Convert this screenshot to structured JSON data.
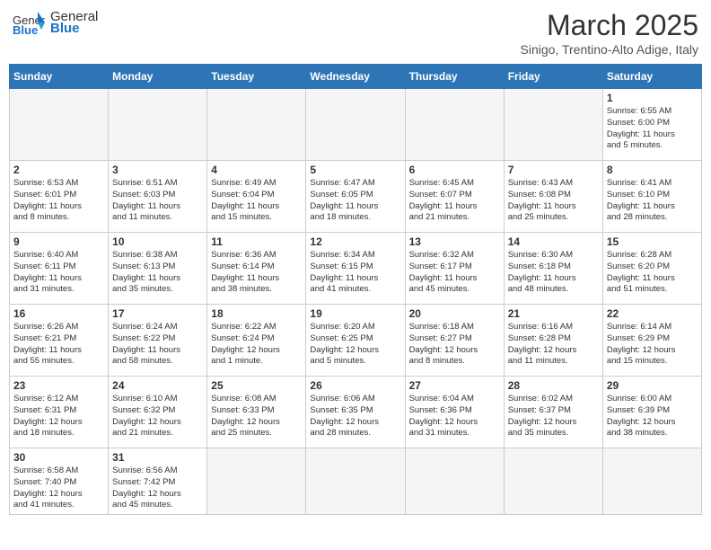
{
  "header": {
    "logo_general": "General",
    "logo_blue": "Blue",
    "title": "March 2025",
    "subtitle": "Sinigo, Trentino-Alto Adige, Italy"
  },
  "weekdays": [
    "Sunday",
    "Monday",
    "Tuesday",
    "Wednesday",
    "Thursday",
    "Friday",
    "Saturday"
  ],
  "weeks": [
    [
      {
        "day": "",
        "info": ""
      },
      {
        "day": "",
        "info": ""
      },
      {
        "day": "",
        "info": ""
      },
      {
        "day": "",
        "info": ""
      },
      {
        "day": "",
        "info": ""
      },
      {
        "day": "",
        "info": ""
      },
      {
        "day": "1",
        "info": "Sunrise: 6:55 AM\nSunset: 6:00 PM\nDaylight: 11 hours\nand 5 minutes."
      }
    ],
    [
      {
        "day": "2",
        "info": "Sunrise: 6:53 AM\nSunset: 6:01 PM\nDaylight: 11 hours\nand 8 minutes."
      },
      {
        "day": "3",
        "info": "Sunrise: 6:51 AM\nSunset: 6:03 PM\nDaylight: 11 hours\nand 11 minutes."
      },
      {
        "day": "4",
        "info": "Sunrise: 6:49 AM\nSunset: 6:04 PM\nDaylight: 11 hours\nand 15 minutes."
      },
      {
        "day": "5",
        "info": "Sunrise: 6:47 AM\nSunset: 6:05 PM\nDaylight: 11 hours\nand 18 minutes."
      },
      {
        "day": "6",
        "info": "Sunrise: 6:45 AM\nSunset: 6:07 PM\nDaylight: 11 hours\nand 21 minutes."
      },
      {
        "day": "7",
        "info": "Sunrise: 6:43 AM\nSunset: 6:08 PM\nDaylight: 11 hours\nand 25 minutes."
      },
      {
        "day": "8",
        "info": "Sunrise: 6:41 AM\nSunset: 6:10 PM\nDaylight: 11 hours\nand 28 minutes."
      }
    ],
    [
      {
        "day": "9",
        "info": "Sunrise: 6:40 AM\nSunset: 6:11 PM\nDaylight: 11 hours\nand 31 minutes."
      },
      {
        "day": "10",
        "info": "Sunrise: 6:38 AM\nSunset: 6:13 PM\nDaylight: 11 hours\nand 35 minutes."
      },
      {
        "day": "11",
        "info": "Sunrise: 6:36 AM\nSunset: 6:14 PM\nDaylight: 11 hours\nand 38 minutes."
      },
      {
        "day": "12",
        "info": "Sunrise: 6:34 AM\nSunset: 6:15 PM\nDaylight: 11 hours\nand 41 minutes."
      },
      {
        "day": "13",
        "info": "Sunrise: 6:32 AM\nSunset: 6:17 PM\nDaylight: 11 hours\nand 45 minutes."
      },
      {
        "day": "14",
        "info": "Sunrise: 6:30 AM\nSunset: 6:18 PM\nDaylight: 11 hours\nand 48 minutes."
      },
      {
        "day": "15",
        "info": "Sunrise: 6:28 AM\nSunset: 6:20 PM\nDaylight: 11 hours\nand 51 minutes."
      }
    ],
    [
      {
        "day": "16",
        "info": "Sunrise: 6:26 AM\nSunset: 6:21 PM\nDaylight: 11 hours\nand 55 minutes."
      },
      {
        "day": "17",
        "info": "Sunrise: 6:24 AM\nSunset: 6:22 PM\nDaylight: 11 hours\nand 58 minutes."
      },
      {
        "day": "18",
        "info": "Sunrise: 6:22 AM\nSunset: 6:24 PM\nDaylight: 12 hours\nand 1 minute."
      },
      {
        "day": "19",
        "info": "Sunrise: 6:20 AM\nSunset: 6:25 PM\nDaylight: 12 hours\nand 5 minutes."
      },
      {
        "day": "20",
        "info": "Sunrise: 6:18 AM\nSunset: 6:27 PM\nDaylight: 12 hours\nand 8 minutes."
      },
      {
        "day": "21",
        "info": "Sunrise: 6:16 AM\nSunset: 6:28 PM\nDaylight: 12 hours\nand 11 minutes."
      },
      {
        "day": "22",
        "info": "Sunrise: 6:14 AM\nSunset: 6:29 PM\nDaylight: 12 hours\nand 15 minutes."
      }
    ],
    [
      {
        "day": "23",
        "info": "Sunrise: 6:12 AM\nSunset: 6:31 PM\nDaylight: 12 hours\nand 18 minutes."
      },
      {
        "day": "24",
        "info": "Sunrise: 6:10 AM\nSunset: 6:32 PM\nDaylight: 12 hours\nand 21 minutes."
      },
      {
        "day": "25",
        "info": "Sunrise: 6:08 AM\nSunset: 6:33 PM\nDaylight: 12 hours\nand 25 minutes."
      },
      {
        "day": "26",
        "info": "Sunrise: 6:06 AM\nSunset: 6:35 PM\nDaylight: 12 hours\nand 28 minutes."
      },
      {
        "day": "27",
        "info": "Sunrise: 6:04 AM\nSunset: 6:36 PM\nDaylight: 12 hours\nand 31 minutes."
      },
      {
        "day": "28",
        "info": "Sunrise: 6:02 AM\nSunset: 6:37 PM\nDaylight: 12 hours\nand 35 minutes."
      },
      {
        "day": "29",
        "info": "Sunrise: 6:00 AM\nSunset: 6:39 PM\nDaylight: 12 hours\nand 38 minutes."
      }
    ],
    [
      {
        "day": "30",
        "info": "Sunrise: 6:58 AM\nSunset: 7:40 PM\nDaylight: 12 hours\nand 41 minutes."
      },
      {
        "day": "31",
        "info": "Sunrise: 6:56 AM\nSunset: 7:42 PM\nDaylight: 12 hours\nand 45 minutes."
      },
      {
        "day": "",
        "info": ""
      },
      {
        "day": "",
        "info": ""
      },
      {
        "day": "",
        "info": ""
      },
      {
        "day": "",
        "info": ""
      },
      {
        "day": "",
        "info": ""
      }
    ]
  ]
}
